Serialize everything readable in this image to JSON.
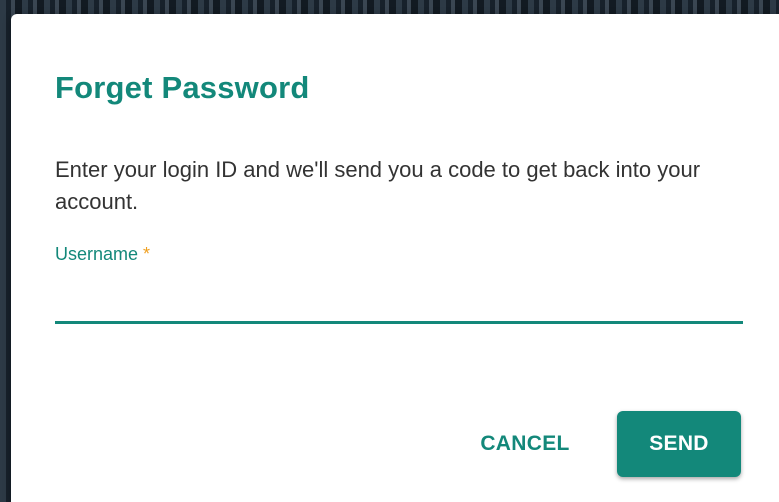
{
  "dialog": {
    "title": "Forget Password",
    "description": "Enter your login ID and we'll send you a code to get back into your account.",
    "username_field": {
      "label": "Username",
      "required_mark": "*",
      "value": "",
      "placeholder": ""
    },
    "actions": {
      "cancel_label": "CANCEL",
      "send_label": "SEND"
    }
  },
  "colors": {
    "accent": "#13887a",
    "required": "#f0a020",
    "text": "#333333"
  }
}
